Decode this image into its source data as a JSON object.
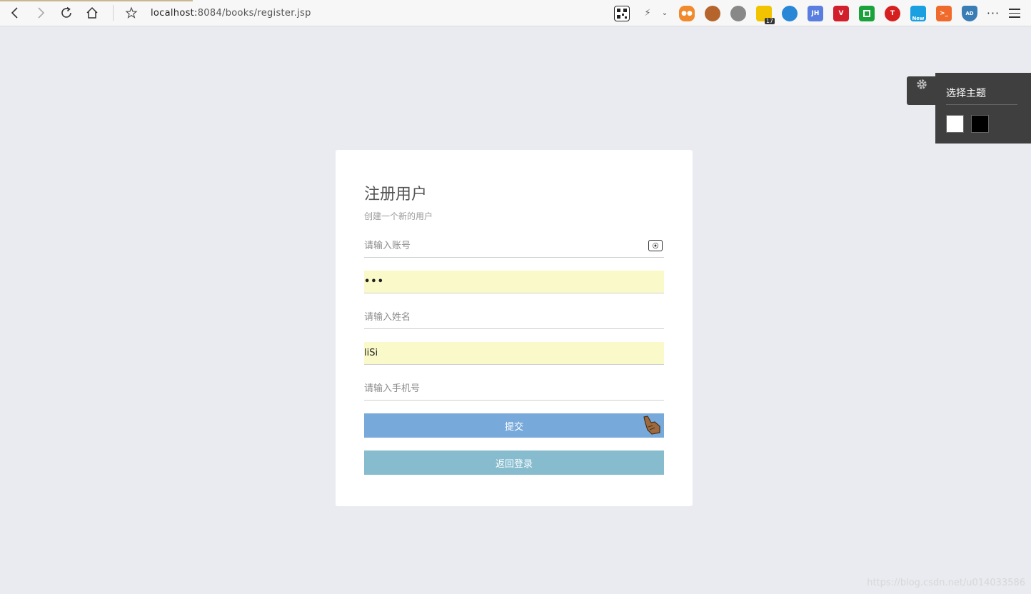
{
  "browser": {
    "url_host": "localhost:",
    "url_rest": "8084/books/register.jsp",
    "extensions": [
      {
        "icon": "qr-code-icon",
        "color": "#222222",
        "label": ""
      },
      {
        "icon": "lightning-icon",
        "color": "#666666",
        "label": ""
      },
      {
        "icon": "gamepad-icon",
        "color": "#f08a2c",
        "label": ""
      },
      {
        "icon": "monkey-icon",
        "color": "#b5652c",
        "label": ""
      },
      {
        "icon": "gear-extension-icon",
        "color": "#888888",
        "label": ""
      },
      {
        "icon": "calendar-icon",
        "color": "#f2c400",
        "label": "",
        "badge": "17"
      },
      {
        "icon": "globe-icon",
        "color": "#2a86d6",
        "label": ""
      },
      {
        "icon": "jh-icon",
        "color": "#5a7ee0",
        "label": "JH"
      },
      {
        "icon": "vivaldi-icon",
        "color": "#d21f2c",
        "label": "V"
      },
      {
        "icon": "green-square-icon",
        "color": "#1aa33a",
        "label": ""
      },
      {
        "icon": "t-circle-icon",
        "color": "#d61f1f",
        "label": "T"
      },
      {
        "icon": "new-icon",
        "color": "#1a9fe0",
        "label": "New"
      },
      {
        "icon": "terminal-icon",
        "color": "#f06a2c",
        "label": ">_"
      },
      {
        "icon": "shield-ad-icon",
        "color": "#3a7db5",
        "label": "AD"
      }
    ]
  },
  "theme_panel": {
    "title": "选择主题",
    "swatches": [
      "#ffffff",
      "#000000"
    ]
  },
  "register": {
    "title": "注册用户",
    "subtitle": "创建一个新的用户",
    "account": {
      "placeholder": "请输入账号",
      "value": ""
    },
    "password": {
      "placeholder": "",
      "value": "•••"
    },
    "name": {
      "placeholder": "请输入姓名",
      "value": ""
    },
    "username": {
      "placeholder": "",
      "value": "liSi"
    },
    "phone": {
      "placeholder": "请输入手机号",
      "value": ""
    },
    "submit_label": "提交",
    "back_label": "返回登录"
  },
  "watermark": "https://blog.csdn.net/u014033586"
}
